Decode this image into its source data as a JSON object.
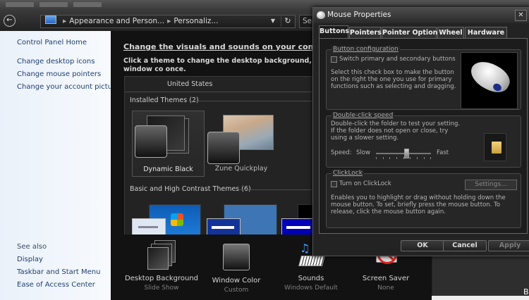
{
  "control_panel": {
    "address": {
      "segments": [
        "Appearance and Person...",
        "Personaliz..."
      ],
      "search_placeholder": "Sea"
    },
    "left_nav": {
      "items": [
        "Control Panel Home",
        "Change desktop icons",
        "Change mouse pointers",
        "Change your account picture"
      ],
      "see_also_label": "See also",
      "see_also": [
        "Display",
        "Taskbar and Start Menu",
        "Ease of Access Center"
      ]
    },
    "main": {
      "heading": "Change the visuals and sounds on your computer",
      "description": "Click a theme to change the desktop background, window co once.",
      "united_states": "United States",
      "installed_header": "Installed Themes (2)",
      "themes": [
        "Dynamic Black",
        "Zune Quickplay"
      ],
      "basic_header": "Basic and High Contrast Themes (6)"
    },
    "bottom": [
      {
        "title": "Desktop Background",
        "sub": "Slide Show"
      },
      {
        "title": "Window Color",
        "sub": "Custom"
      },
      {
        "title": "Sounds",
        "sub": "Windows Default"
      },
      {
        "title": "Screen Saver",
        "sub": "None"
      }
    ],
    "corner_letter": "B"
  },
  "dialog": {
    "title": "Mouse Properties",
    "tabs": [
      "Buttons",
      "Pointers",
      "Pointer Options",
      "Wheel",
      "Hardware"
    ],
    "active_tab": "Buttons",
    "button_config": {
      "legend": "Button configuration",
      "checkbox_label": "Switch primary and secondary buttons",
      "description": "Select this check box to make the button on the right the one you use for primary functions such as selecting and dragging."
    },
    "double_click": {
      "legend": "Double-click speed",
      "description": "Double-click the folder to test your setting. If the folder does not open or close, try using a slower setting.",
      "speed_label": "Speed:",
      "slow_label": "Slow",
      "fast_label": "Fast",
      "speed_value": 0.55
    },
    "clicklock": {
      "legend": "ClickLock",
      "checkbox_label": "Turn on ClickLock",
      "settings_button": "Settings...",
      "description": "Enables you to highlight or drag without holding down the mouse button. To set, briefly press the mouse button. To release, click the mouse button again."
    },
    "buttons": {
      "ok": "OK",
      "cancel": "Cancel",
      "apply": "Apply"
    }
  }
}
